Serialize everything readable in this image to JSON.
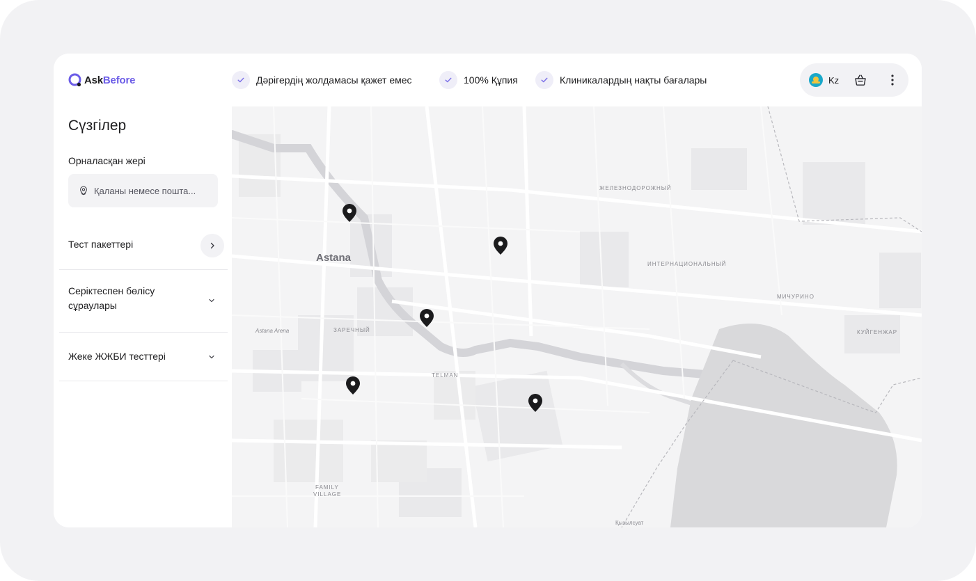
{
  "brand": {
    "name_part1": "Ask",
    "name_part2": "Before",
    "accent": "#6b5ce7"
  },
  "header": {
    "features": [
      {
        "label": "Дәрігердің жолдамасы қажет емес",
        "icon": "check-icon"
      },
      {
        "label": "100% Құпия",
        "icon": "check-icon"
      },
      {
        "label": "Клиникалардың нақты бағалары",
        "icon": "check-icon"
      }
    ],
    "language": {
      "label": "Kz",
      "icon": "kazakhstan-flag-icon"
    },
    "basket_icon": "basket-icon",
    "menu_icon": "more-vertical-icon"
  },
  "sidebar": {
    "title": "Сүзгілер",
    "location": {
      "label": "Орналасқан жері",
      "placeholder": "Қаланы немесе пошта...",
      "icon": "location-pin-icon"
    },
    "filters": [
      {
        "label": "Тест пакеттері",
        "icon": "chevron-right-icon"
      },
      {
        "label": "Серіктеспен бөлісу сұраулары",
        "icon": "chevron-down-icon"
      },
      {
        "label": "Жеке ЖЖБИ тесттері",
        "icon": "chevron-down-icon"
      }
    ]
  },
  "map": {
    "labels": {
      "city": "Astana",
      "zheleznodorozhny": "ЖЕЛЕЗНОДОРОЖНЫЙ",
      "internatsionalny": "ИНТЕРНАЦИОНАЛЬНЫЙ",
      "michurino": "МИЧУРИНО",
      "kuigenzhar": "КУЙГЕНЖАР",
      "astana_arena": "Astana Arena",
      "zarechny": "ЗАРЕЧНЫЙ",
      "telman": "TELMAN",
      "family": "FAMILY",
      "village": "VILLAGE",
      "kyzylsuat": "Қызылсуат"
    },
    "marker_icon": "map-marker-icon",
    "marker_count": 5
  }
}
